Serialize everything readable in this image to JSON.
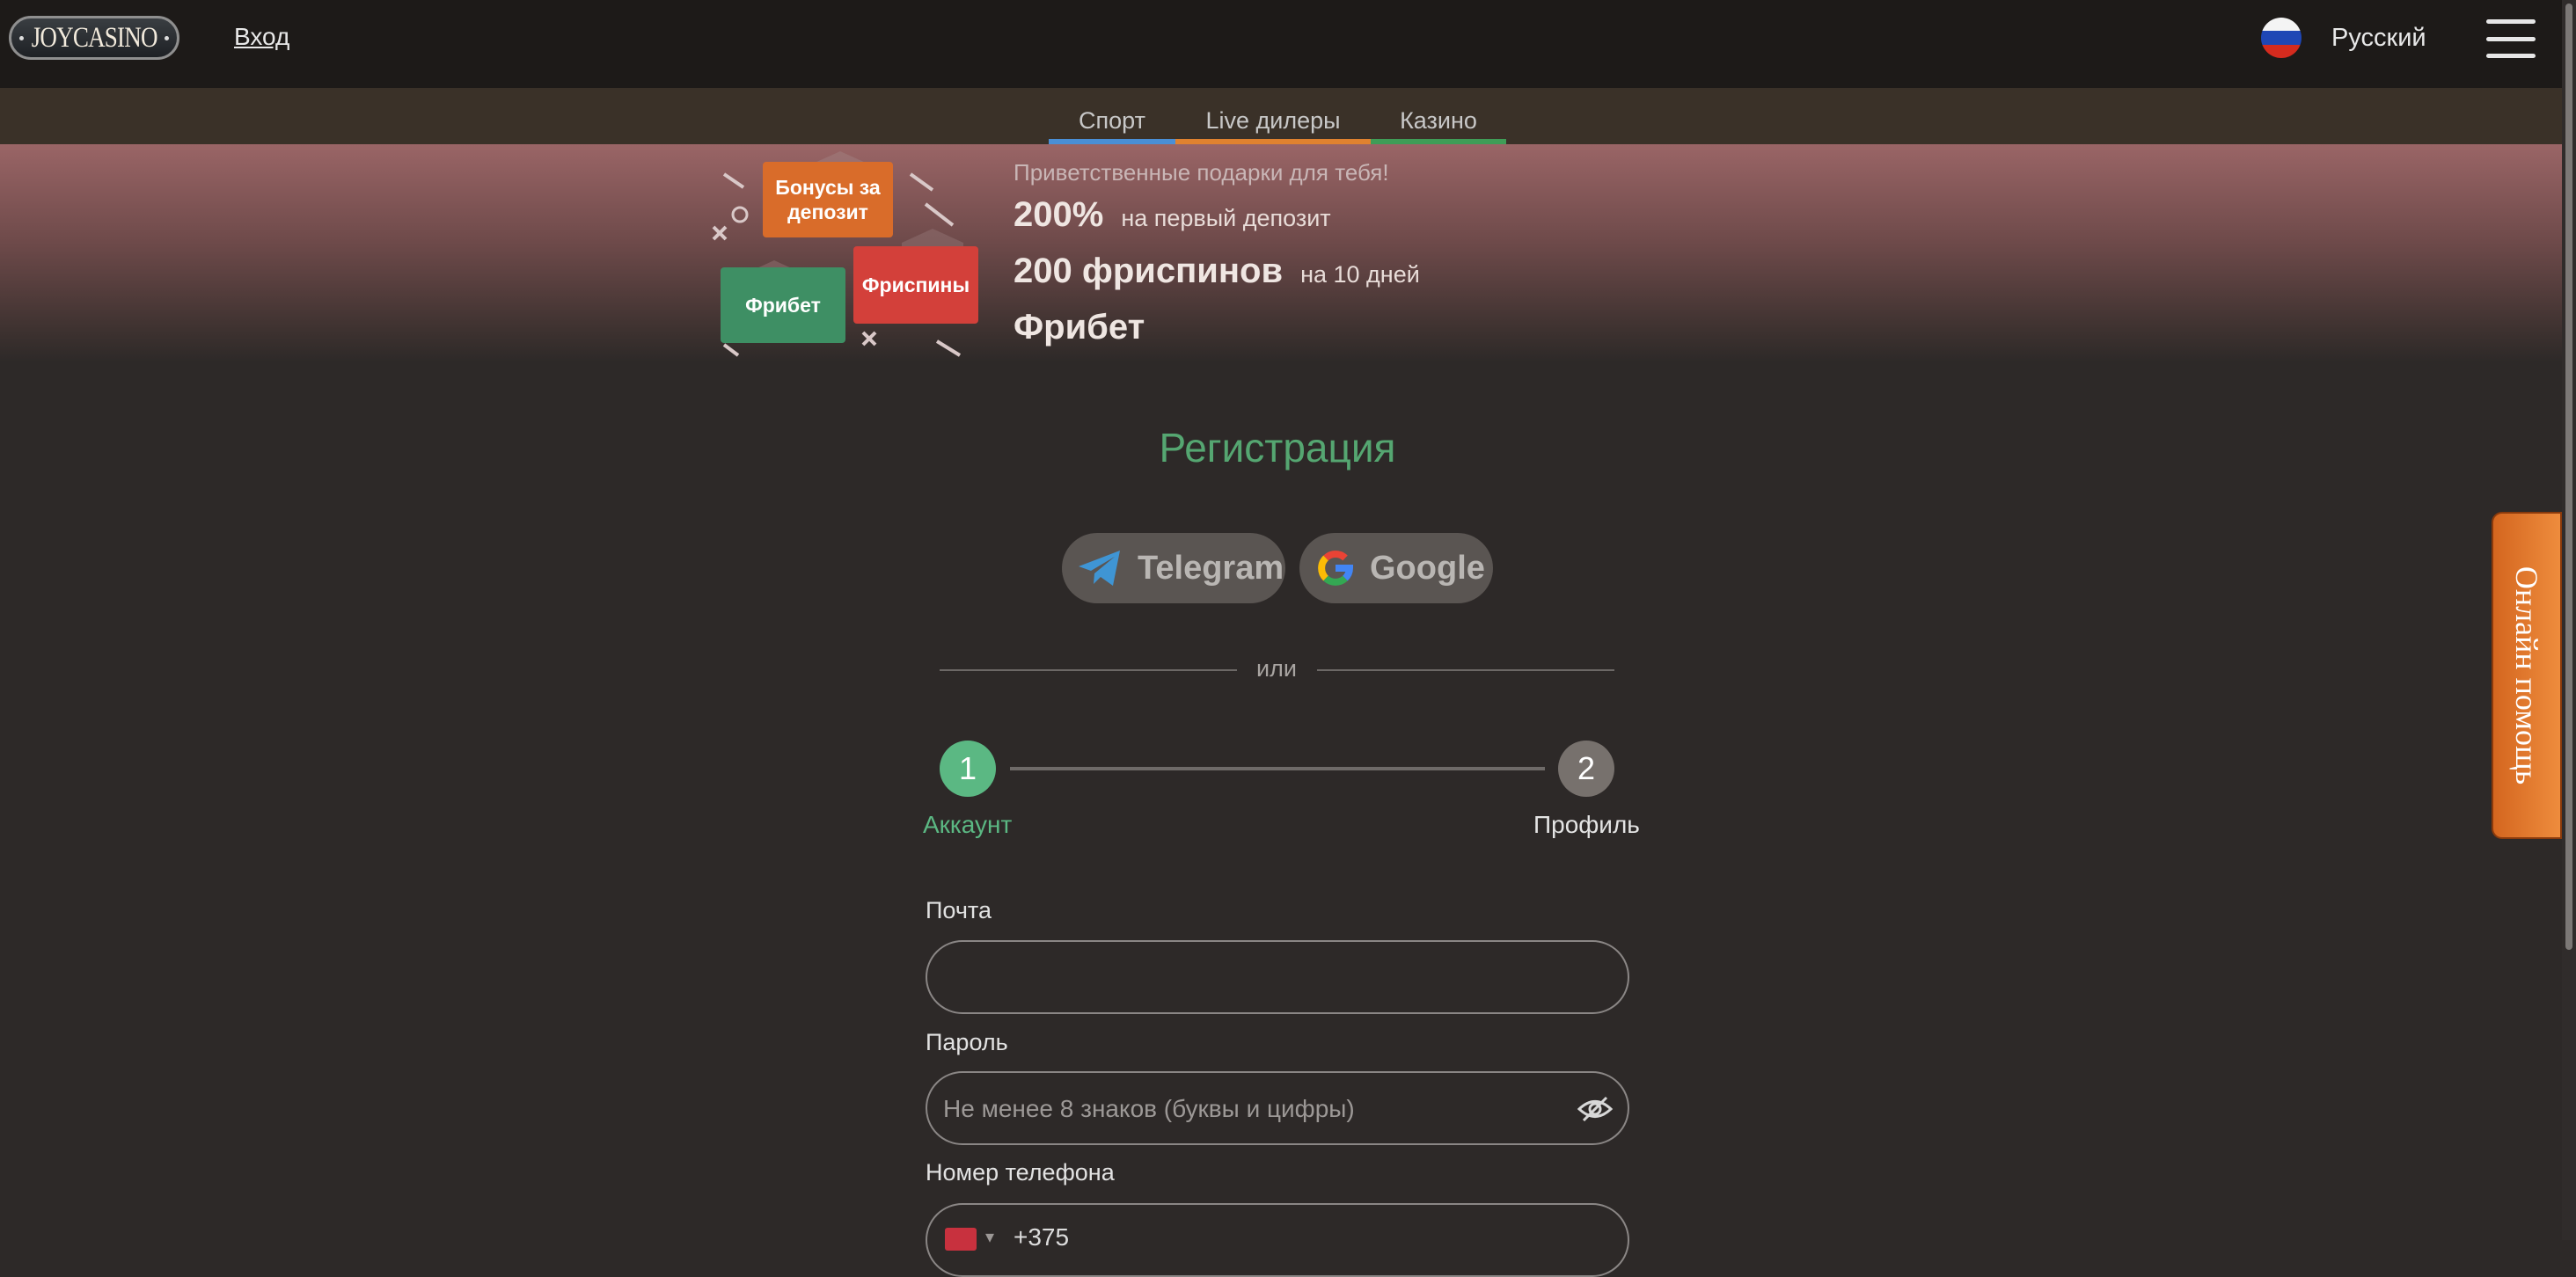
{
  "header": {
    "logo_text": "JOYCASINO",
    "login_label": "Вход",
    "language": "Русский"
  },
  "tabs": [
    {
      "label": "Спорт",
      "color": "#4a8fd6"
    },
    {
      "label": "Live дилеры",
      "color": "#e0822f"
    },
    {
      "label": "Казино",
      "color": "#3f9d57"
    }
  ],
  "promo": {
    "subtitle": "Приветственные подарки для тебя!",
    "line1_big": "200%",
    "line1_small": "на первый депозит",
    "line2_big": "200 фриспинов",
    "line2_small": "на 10 дней",
    "line3_big": "Фрибет",
    "chips": {
      "deposit": "Бонусы за депозит",
      "freespins": "Фриспины",
      "freebet": "Фрибет"
    }
  },
  "registration": {
    "title": "Регистрация",
    "telegram_label": "Telegram",
    "google_label": "Google",
    "or_label": "или",
    "steps": [
      {
        "number": "1",
        "label": "Аккаунт"
      },
      {
        "number": "2",
        "label": "Профиль"
      }
    ],
    "email_label": "Почта",
    "email_value": "",
    "password_label": "Пароль",
    "password_placeholder": "Не менее 8 знаков (буквы и цифры)",
    "phone_label": "Номер телефона",
    "phone_value": "+375"
  },
  "help_label": "Онлайн помощь",
  "colors": {
    "accent_green": "#55a671",
    "step_active": "#5bb883",
    "step_inactive": "#77716d",
    "help_orange": "#e77a2f"
  }
}
